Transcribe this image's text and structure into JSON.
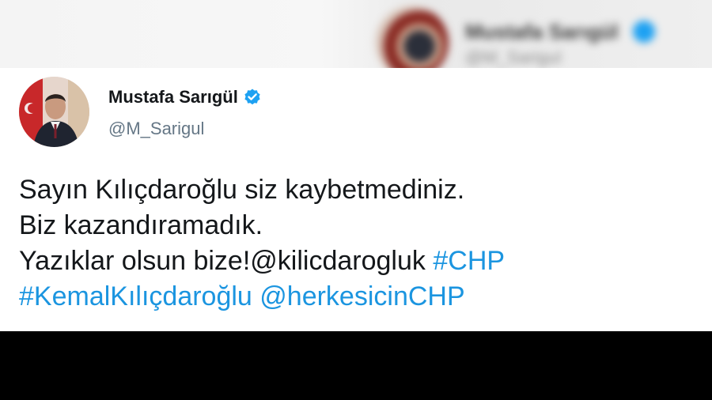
{
  "colors": {
    "link": "#1b95e0",
    "text": "#14171a",
    "muted": "#657786",
    "verified": "#1da1f2",
    "bottom_bar": "#000000"
  },
  "background_blur": {
    "name": "Mustafa Sarıgül",
    "handle": "@M_Sarigul",
    "icons": [
      "avatar",
      "verified-badge-icon"
    ]
  },
  "tweet": {
    "author": {
      "name": "Mustafa Sarıgül",
      "handle": "@M_Sarigul",
      "verified_icon": "verified-badge-icon"
    },
    "text": {
      "line1": "Sayın Kılıçdaroğlu siz kaybetmediniz.",
      "line2": "Biz kazandıramadık.",
      "line3_text": "Yazıklar olsun bize!",
      "mention1": "@kilicdarogluk",
      "hashtag1": "#CHP",
      "hashtag2": "#KemalKılıçdaroğlu",
      "mention2": "@herkesicinCHP"
    }
  }
}
